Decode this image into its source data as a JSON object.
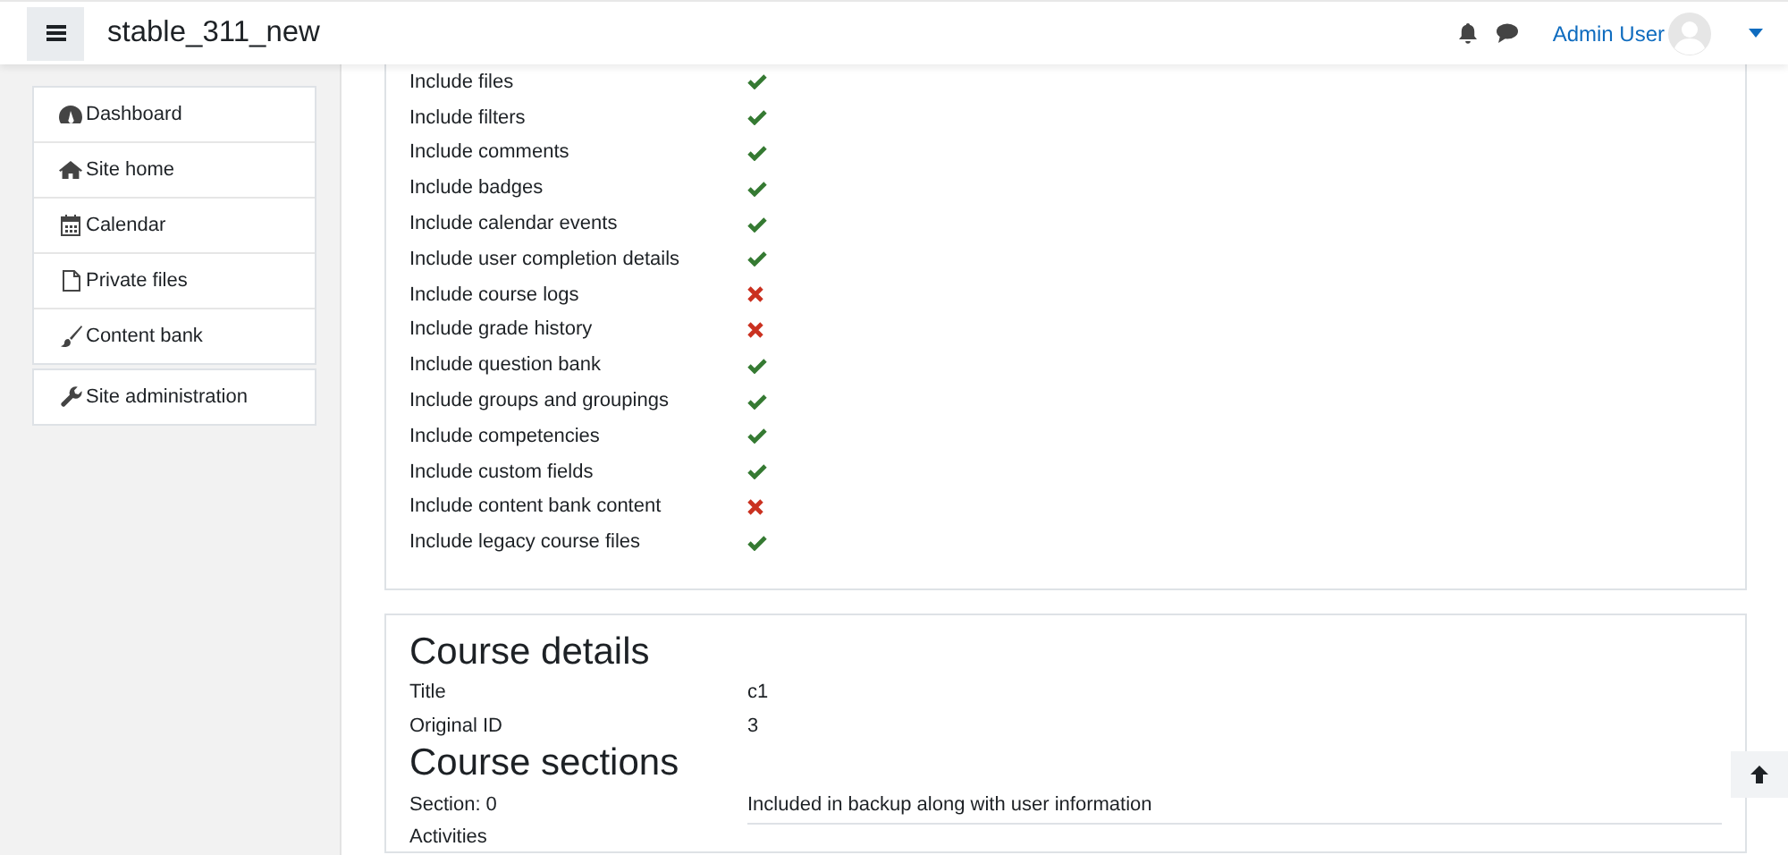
{
  "navbar": {
    "site_name": "stable_311_new",
    "user_name": "Admin User"
  },
  "sidebar": {
    "items": [
      {
        "label": "Dashboard",
        "selected": false
      },
      {
        "label": "Site home",
        "selected": false
      },
      {
        "label": "Calendar",
        "selected": false
      },
      {
        "label": "Private files",
        "selected": false
      },
      {
        "label": "Content bank",
        "selected": false
      }
    ],
    "admin_item": {
      "label": "Site administration"
    }
  },
  "backup_settings": [
    {
      "label": "Include files",
      "included": true
    },
    {
      "label": "Include filters",
      "included": true
    },
    {
      "label": "Include comments",
      "included": true
    },
    {
      "label": "Include badges",
      "included": true
    },
    {
      "label": "Include calendar events",
      "included": true
    },
    {
      "label": "Include user completion details",
      "included": true
    },
    {
      "label": "Include course logs",
      "included": false
    },
    {
      "label": "Include grade history",
      "included": false
    },
    {
      "label": "Include question bank",
      "included": true
    },
    {
      "label": "Include groups and groupings",
      "included": true
    },
    {
      "label": "Include competencies",
      "included": true
    },
    {
      "label": "Include custom fields",
      "included": true
    },
    {
      "label": "Include content bank content",
      "included": false
    },
    {
      "label": "Include legacy course files",
      "included": true
    }
  ],
  "course_details": {
    "heading": "Course details",
    "rows": [
      {
        "label": "Title",
        "value": "c1"
      },
      {
        "label": "Original ID",
        "value": "3"
      }
    ]
  },
  "course_sections": {
    "heading": "Course sections",
    "rows": [
      {
        "label": "Section: 0",
        "value": "Included in backup along with user information"
      }
    ],
    "activities_label": "Activities"
  }
}
